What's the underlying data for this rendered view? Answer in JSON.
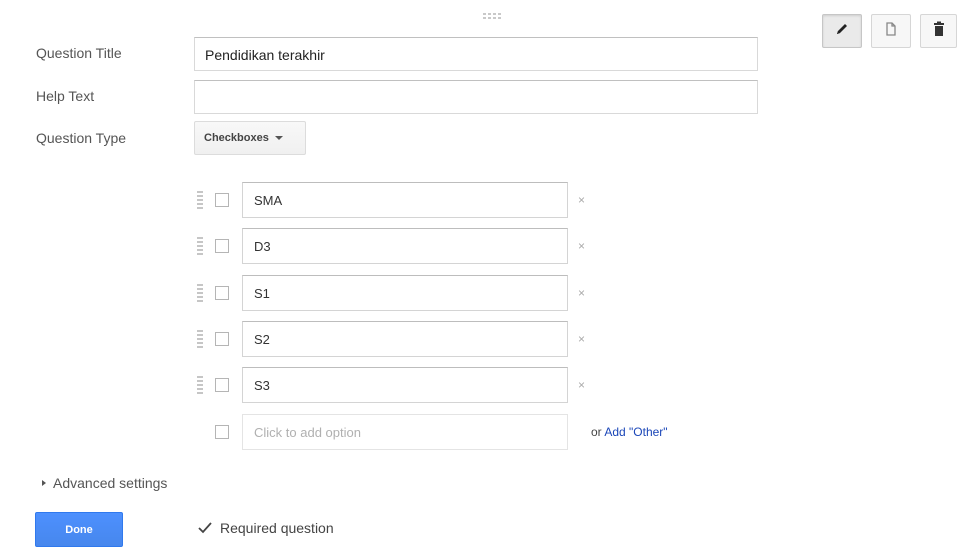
{
  "form": {
    "labels": {
      "question_title": "Question Title",
      "help_text": "Help Text",
      "question_type": "Question Type"
    },
    "question_title_value": "Pendidikan terakhir",
    "help_text_value": "",
    "question_type_value": "Checkboxes"
  },
  "options": [
    {
      "label": "SMA",
      "remove": "×"
    },
    {
      "label": "D3",
      "remove": "×"
    },
    {
      "label": "S1",
      "remove": "×"
    },
    {
      "label": "S2",
      "remove": "×"
    },
    {
      "label": "S3",
      "remove": "×"
    }
  ],
  "add_option": {
    "placeholder": "Click to add option",
    "or_text": "or ",
    "add_other_link": "Add \"Other\""
  },
  "footer": {
    "advanced_settings": "Advanced settings",
    "done_button": "Done",
    "required_label": "Required question",
    "required_checked": true
  },
  "toolbar": {
    "icons": [
      "pencil-icon",
      "copy-icon",
      "trash-icon"
    ]
  },
  "colors": {
    "primary_blue": "#4d90fe",
    "link_blue": "#1a46b8"
  }
}
